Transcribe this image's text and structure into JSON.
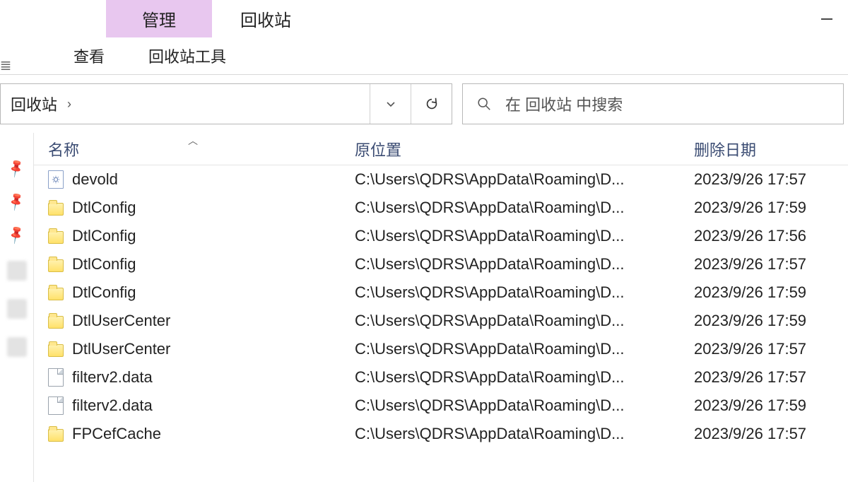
{
  "title": {
    "manage": "管理",
    "app": "回收站"
  },
  "ribbon": {
    "view": "查看",
    "tools": "回收站工具",
    "left_edge": "≣"
  },
  "address": {
    "crumb": "回收站",
    "separator": "›"
  },
  "search": {
    "placeholder": "在 回收站 中搜索"
  },
  "columns": {
    "name": "名称",
    "original": "原位置",
    "deleted": "删除日期"
  },
  "rows": [
    {
      "icon": "config",
      "name": "devold",
      "original": "C:\\Users\\QDRS\\AppData\\Roaming\\D...",
      "deleted": "2023/9/26 17:57"
    },
    {
      "icon": "folder",
      "name": "DtlConfig",
      "original": "C:\\Users\\QDRS\\AppData\\Roaming\\D...",
      "deleted": "2023/9/26 17:59"
    },
    {
      "icon": "folder",
      "name": "DtlConfig",
      "original": "C:\\Users\\QDRS\\AppData\\Roaming\\D...",
      "deleted": "2023/9/26 17:56"
    },
    {
      "icon": "folder",
      "name": "DtlConfig",
      "original": "C:\\Users\\QDRS\\AppData\\Roaming\\D...",
      "deleted": "2023/9/26 17:57"
    },
    {
      "icon": "folder",
      "name": "DtlConfig",
      "original": "C:\\Users\\QDRS\\AppData\\Roaming\\D...",
      "deleted": "2023/9/26 17:59"
    },
    {
      "icon": "folder",
      "name": "DtlUserCenter",
      "original": "C:\\Users\\QDRS\\AppData\\Roaming\\D...",
      "deleted": "2023/9/26 17:59"
    },
    {
      "icon": "folder",
      "name": "DtlUserCenter",
      "original": "C:\\Users\\QDRS\\AppData\\Roaming\\D...",
      "deleted": "2023/9/26 17:57"
    },
    {
      "icon": "file",
      "name": "filterv2.data",
      "original": "C:\\Users\\QDRS\\AppData\\Roaming\\D...",
      "deleted": "2023/9/26 17:57"
    },
    {
      "icon": "file",
      "name": "filterv2.data",
      "original": "C:\\Users\\QDRS\\AppData\\Roaming\\D...",
      "deleted": "2023/9/26 17:59"
    },
    {
      "icon": "folder",
      "name": "FPCefCache",
      "original": "C:\\Users\\QDRS\\AppData\\Roaming\\D...",
      "deleted": "2023/9/26 17:57"
    }
  ]
}
